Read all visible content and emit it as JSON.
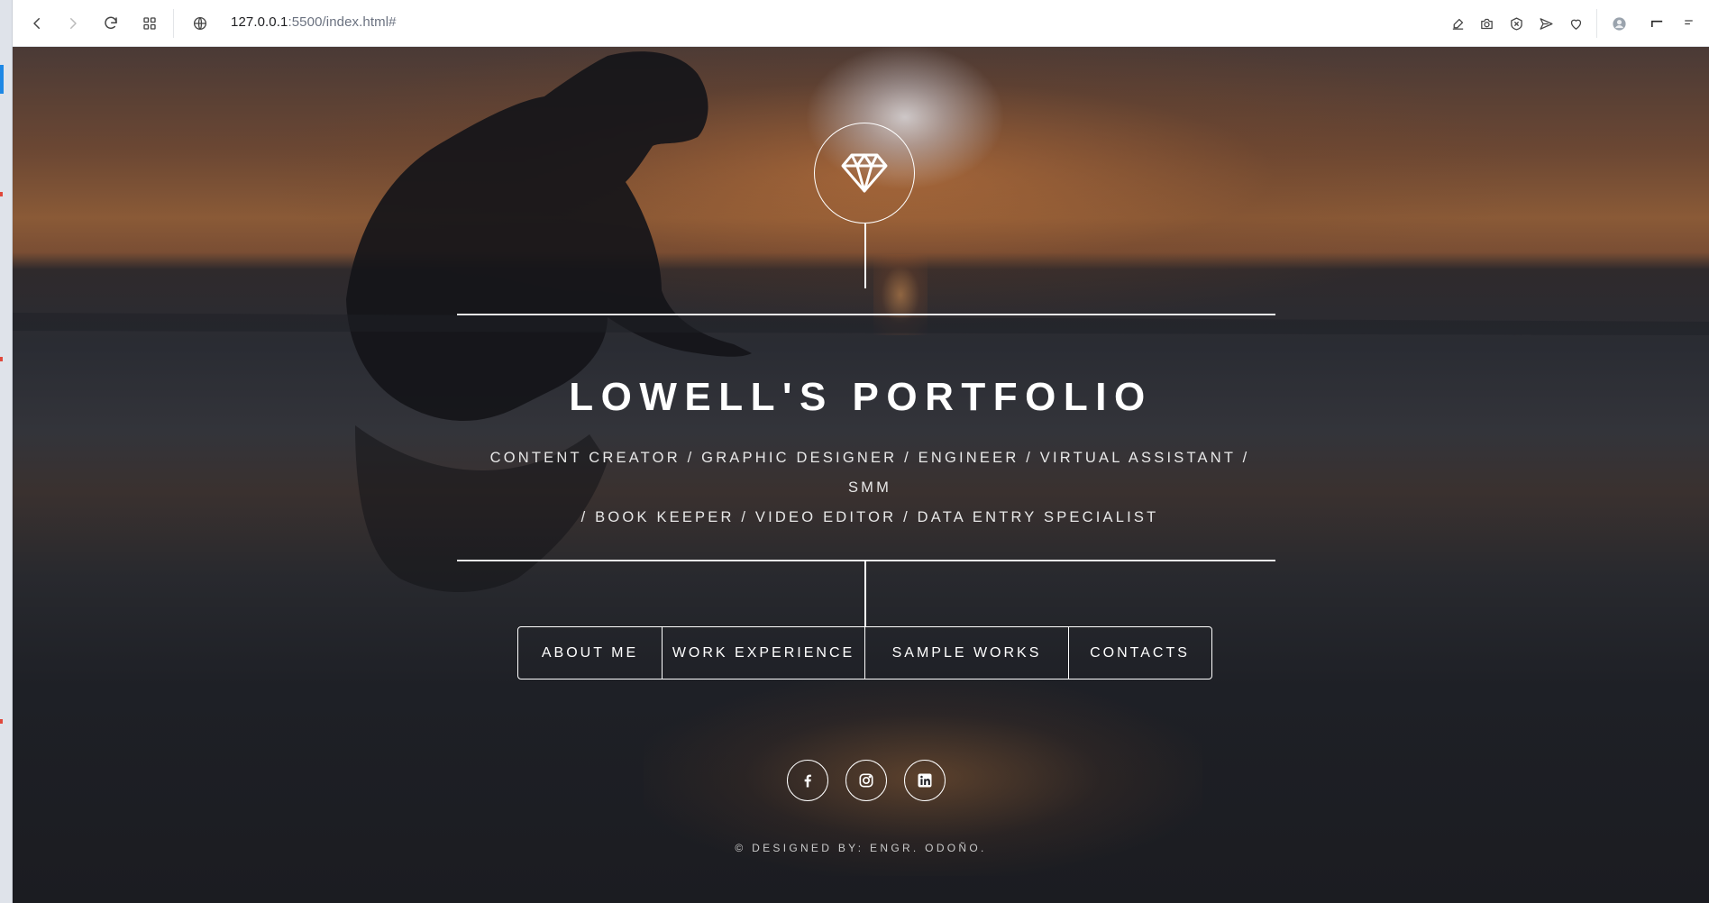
{
  "browser": {
    "url_host": "127.0.0.1",
    "url_rest": ":5500/index.html#",
    "back_icon": "back-arrow-icon",
    "forward_icon": "forward-arrow-icon",
    "reload_icon": "reload-icon",
    "apps_icon": "apps-grid-icon",
    "site_info_icon": "globe-icon"
  },
  "hero": {
    "logo_icon": "diamond-icon",
    "title": "LOWELL'S PORTFOLIO",
    "subtitle_line1": "Content Creator / Graphic Designer / Engineer / Virtual Assistant / SMM",
    "subtitle_line2": "/ Book Keeper / Video Editor / Data Entry Specialist"
  },
  "menu": [
    {
      "label": "About Me"
    },
    {
      "label": "Work Experience"
    },
    {
      "label": "Sample Works"
    },
    {
      "label": "Contacts"
    }
  ],
  "social": [
    {
      "icon": "facebook-icon"
    },
    {
      "icon": "instagram-icon"
    },
    {
      "icon": "linkedin-icon"
    }
  ],
  "footer": {
    "credit": "© Designed by: Engr. Odoño."
  },
  "colors": {
    "text": "#ffffff",
    "line": "#e9e9e9",
    "background": "#1b1c22"
  }
}
